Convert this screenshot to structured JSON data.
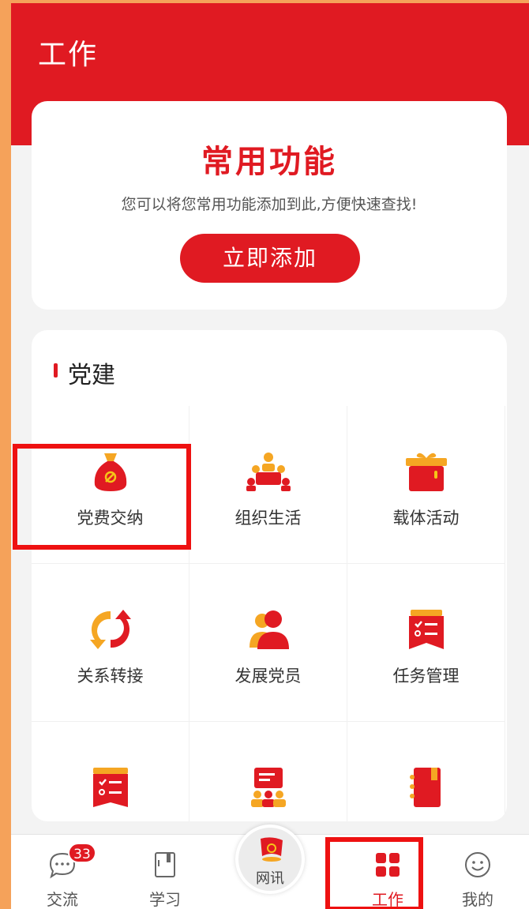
{
  "header": {
    "title": "工作"
  },
  "common": {
    "title": "常用功能",
    "description": "您可以将您常用功能添加到此,方便快速查找!",
    "add_button": "立即添加"
  },
  "party": {
    "title": "党建",
    "items": [
      {
        "label": "党费交纳",
        "icon": "money-bag-icon"
      },
      {
        "label": "组织生活",
        "icon": "meeting-icon"
      },
      {
        "label": "载体活动",
        "icon": "gift-box-icon"
      },
      {
        "label": "关系转接",
        "icon": "transfer-arrows-icon"
      },
      {
        "label": "发展党员",
        "icon": "add-member-icon"
      },
      {
        "label": "任务管理",
        "icon": "task-list-icon"
      },
      {
        "label": "",
        "icon": "checklist-icon"
      },
      {
        "label": "",
        "icon": "presentation-icon"
      },
      {
        "label": "",
        "icon": "notebook-icon"
      }
    ]
  },
  "tabbar": {
    "items": [
      {
        "label": "交流",
        "icon": "chat-bubble-icon",
        "badge": "33"
      },
      {
        "label": "学习",
        "icon": "book-icon"
      },
      {
        "label": "网讯",
        "icon": "party-flag-icon"
      },
      {
        "label": "工作",
        "icon": "grid-icon",
        "active": true
      },
      {
        "label": "我的",
        "icon": "smiley-face-icon"
      }
    ]
  },
  "colors": {
    "accent": "#e01a22",
    "icon_orange": "#f5a623",
    "highlight": "#ee1111"
  }
}
